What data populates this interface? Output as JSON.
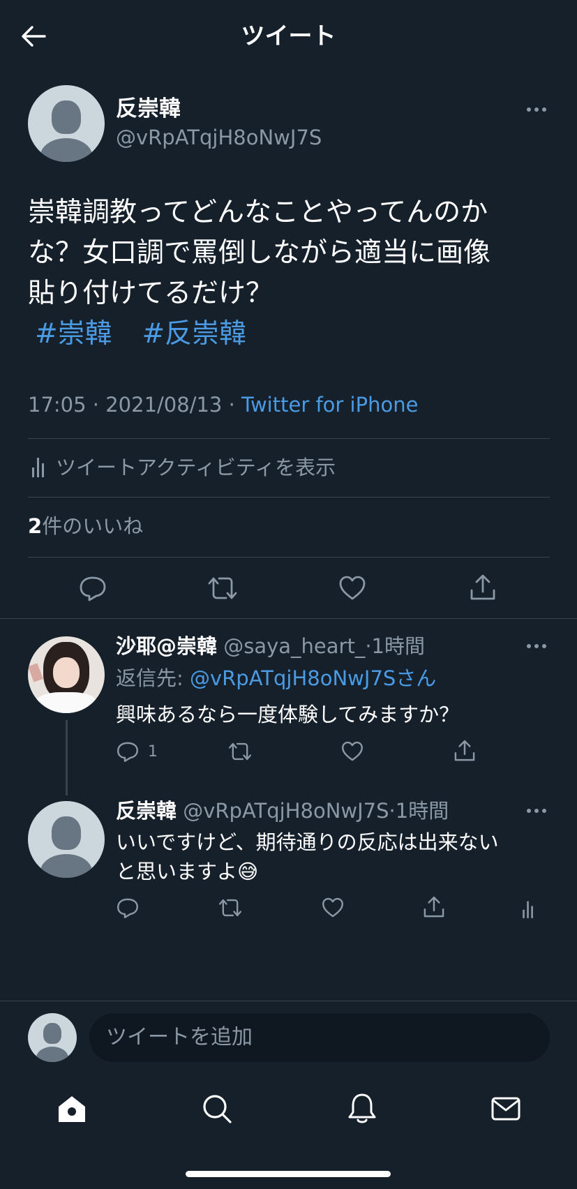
{
  "header": {
    "title": "ツイート",
    "back_icon": "arrow-left-icon"
  },
  "main_tweet": {
    "display_name": "反崇韓",
    "handle": "@vRpATqjH8oNwJ7S",
    "text_lines": [
      "崇韓調教ってどんなことやってんのか",
      "な？女口調で罵倒しながら適当に画像",
      "貼り付けてるだけ？"
    ],
    "hashtags": [
      "#崇韓",
      "#反崇韓"
    ],
    "time": "17:05",
    "date": "2021/08/13",
    "separator": "·",
    "source": "Twitter for iPhone",
    "activity_label": "ツイートアクティビティを表示",
    "likes_count": "2",
    "likes_label": "件のいいね"
  },
  "replies": [
    {
      "display_name": "沙耶@崇韓",
      "handle": "@saya_heart_",
      "time": "·1時間",
      "reply_to_prefix": "返信先: ",
      "reply_to_handle": "@vRpATqjH8oNwJ7Sさん",
      "text": "興味あるなら一度体験してみますか？",
      "reply_count": "1"
    },
    {
      "display_name": "反崇韓",
      "handle": "@vRpATqjH8oNwJ7S",
      "time": "·1時間",
      "text_lines": [
        "いいですけど、期待通りの反応は出来ない",
        "と思いますよ"
      ],
      "emoji": "😅"
    }
  ],
  "composer": {
    "placeholder": "ツイートを追加"
  },
  "tab_bar": {
    "items": [
      "home-icon",
      "search-icon",
      "bell-icon",
      "mail-icon"
    ]
  },
  "colors": {
    "background": "#15202b",
    "accent": "#4a9be4",
    "muted": "#8b98a5",
    "divider": "#38444d"
  }
}
